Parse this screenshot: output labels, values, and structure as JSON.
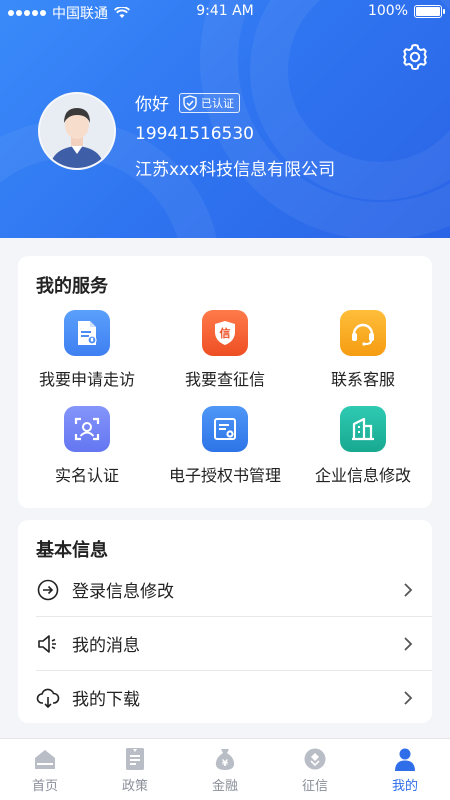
{
  "status_bar": {
    "carrier": "中国联通",
    "time": "9:41 AM",
    "battery": "100%"
  },
  "profile": {
    "greeting": "你好",
    "verified_label": "已认证",
    "phone": "19941516530",
    "company": "江苏xxx科技信息有限公司"
  },
  "services": {
    "title": "我的服务",
    "items": [
      {
        "label": "我要申请走访",
        "icon": "document-file-icon",
        "color": "#4a8df7"
      },
      {
        "label": "我要查征信",
        "icon": "credit-shield-icon",
        "color": "#f25c2e"
      },
      {
        "label": "联系客服",
        "icon": "headset-icon",
        "color": "#f7a81b"
      },
      {
        "label": "实名认证",
        "icon": "face-scan-icon",
        "color": "#6f82f5"
      },
      {
        "label": "电子授权书管理",
        "icon": "certificate-icon",
        "color": "#3d83ee"
      },
      {
        "label": "企业信息修改",
        "icon": "building-icon",
        "color": "#23b8a0"
      }
    ]
  },
  "basic_info": {
    "title": "基本信息",
    "rows": [
      {
        "label": "登录信息修改",
        "icon": "arrow-right-circle-icon"
      },
      {
        "label": "我的消息",
        "icon": "speaker-icon"
      },
      {
        "label": "我的下载",
        "icon": "cloud-download-icon"
      }
    ]
  },
  "tabbar": {
    "items": [
      {
        "label": "首页",
        "icon": "home-icon",
        "active": false
      },
      {
        "label": "政策",
        "icon": "policy-doc-icon",
        "active": false
      },
      {
        "label": "金融",
        "icon": "money-bag-icon",
        "active": false
      },
      {
        "label": "征信",
        "icon": "credit-icon",
        "active": false
      },
      {
        "label": "我的",
        "icon": "user-icon",
        "active": true
      }
    ]
  },
  "colors": {
    "header_blue": "#2f74f0",
    "active_tab": "#2f6ee8",
    "inactive_tab": "#8a8f99"
  }
}
